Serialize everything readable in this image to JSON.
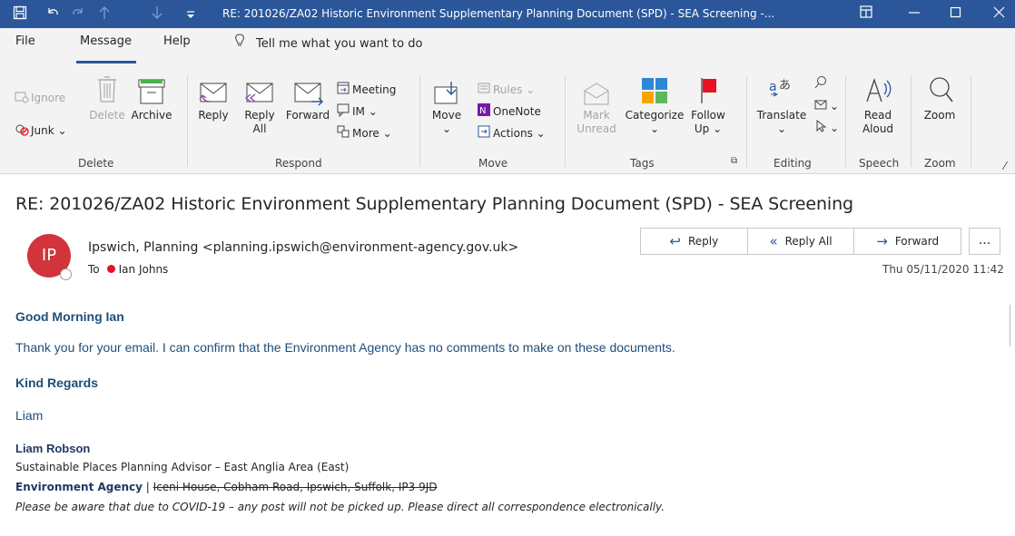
{
  "window": {
    "title": "RE: 201026/ZA02 Historic Environment Supplementary Planning Document (SPD) - SEA Screening -...",
    "quick_access": [
      "save-icon",
      "undo-icon",
      "redo-icon",
      "up-icon",
      "down-icon",
      "customize-icon"
    ],
    "controls": [
      "restore-ribbon-icon",
      "minimize-icon",
      "maximize-icon",
      "close-icon"
    ]
  },
  "menu": {
    "tabs": [
      "File",
      "Message",
      "Help"
    ],
    "active_tab": "Message",
    "tell_me": "Tell me what you want to do"
  },
  "ribbon": {
    "delete_group": {
      "label": "Delete",
      "ignore": "Ignore",
      "junk": "Junk",
      "delete": "Delete",
      "archive": "Archive"
    },
    "respond_group": {
      "label": "Respond",
      "reply": "Reply",
      "reply_all_1": "Reply",
      "reply_all_2": "All",
      "forward": "Forward",
      "meeting": "Meeting",
      "im": "IM",
      "more": "More"
    },
    "move_group": {
      "label": "Move",
      "move": "Move",
      "rules": "Rules",
      "onenote": "OneNote",
      "actions": "Actions"
    },
    "tags_group": {
      "label": "Tags",
      "mark_1": "Mark",
      "mark_2": "Unread",
      "categorize": "Categorize",
      "follow_1": "Follow",
      "follow_2": "Up"
    },
    "editing_group": {
      "label": "Editing",
      "translate": "Translate"
    },
    "speech_group": {
      "label": "Speech",
      "read_1": "Read",
      "read_2": "Aloud"
    },
    "zoom_group": {
      "label": "Zoom",
      "zoom": "Zoom"
    }
  },
  "email": {
    "subject": "RE: 201026/ZA02 Historic Environment Supplementary Planning Document (SPD) - SEA Screening",
    "avatar_initials": "IP",
    "sender": "Ipswich, Planning <planning.ipswich@environment-agency.gov.uk>",
    "to_label": "To",
    "recipient": "Ian Johns",
    "date": "Thu 05/11/2020 11:42",
    "actions": {
      "reply": "Reply",
      "reply_all": "Reply All",
      "forward": "Forward",
      "more": "..."
    },
    "body": {
      "greeting": "Good Morning Ian",
      "line1": "Thank you for your email. I can confirm that the Environment Agency has no comments to make on these documents.",
      "regards": "Kind Regards",
      "signoff": "Liam"
    },
    "signature": {
      "name": "Liam Robson",
      "role": "Sustainable Places Planning Advisor – East Anglia Area (East)",
      "agency": "Environment Agency",
      "sep": " | ",
      "address": "Iceni House, Cobham Road, Ipswich, Suffolk, IP3 9JD",
      "covid_note": "Please be aware that due to COVID-19 – any post will not be picked up. Please direct all correspondence electronically."
    }
  },
  "colors": {
    "titlebar": "#2b579a",
    "accent": "#2b579a",
    "avatar": "#d1343b",
    "body_text": "#1f4e79",
    "presence_busy": "#e81123"
  }
}
